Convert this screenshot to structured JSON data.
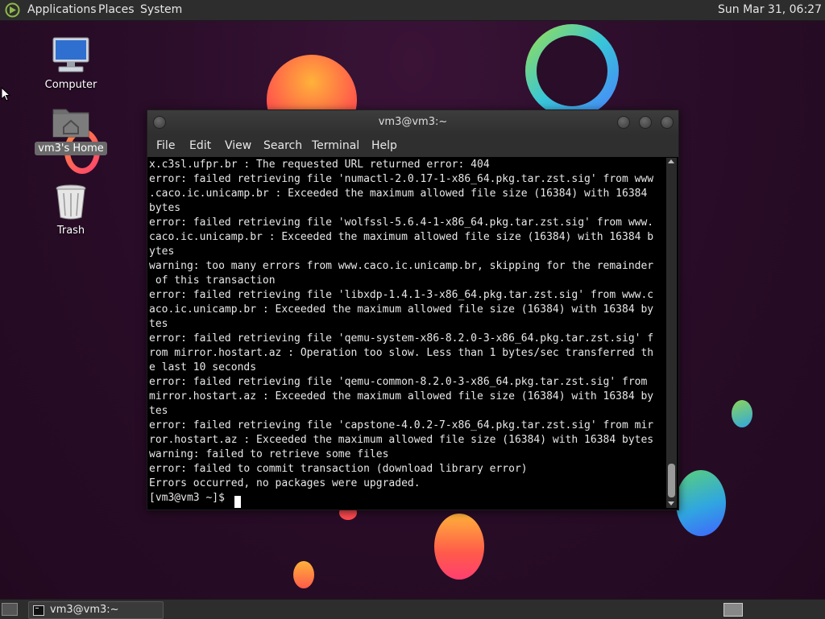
{
  "top_panel": {
    "menus": [
      "Applications",
      "Places",
      "System"
    ],
    "clock": "Sun Mar 31, 06:27"
  },
  "desktop": {
    "icons": [
      {
        "label": "Computer",
        "icon": "computer-icon"
      },
      {
        "label": "vm3's Home",
        "icon": "home-folder-icon"
      },
      {
        "label": "Trash",
        "icon": "trash-icon"
      }
    ]
  },
  "terminal": {
    "title": "vm3@vm3:~",
    "menu": [
      "File",
      "Edit",
      "View",
      "Search",
      "Terminal",
      "Help"
    ],
    "lines": [
      "x.c3sl.ufpr.br : The requested URL returned error: 404",
      "error: failed retrieving file 'numactl-2.0.17-1-x86_64.pkg.tar.zst.sig' from www",
      ".caco.ic.unicamp.br : Exceeded the maximum allowed file size (16384) with 16384",
      "bytes",
      "error: failed retrieving file 'wolfssl-5.6.4-1-x86_64.pkg.tar.zst.sig' from www.",
      "caco.ic.unicamp.br : Exceeded the maximum allowed file size (16384) with 16384 b",
      "ytes",
      "warning: too many errors from www.caco.ic.unicamp.br, skipping for the remainder",
      " of this transaction",
      "error: failed retrieving file 'libxdp-1.4.1-3-x86_64.pkg.tar.zst.sig' from www.c",
      "aco.ic.unicamp.br : Exceeded the maximum allowed file size (16384) with 16384 by",
      "tes",
      "error: failed retrieving file 'qemu-system-x86-8.2.0-3-x86_64.pkg.tar.zst.sig' f",
      "rom mirror.hostart.az : Operation too slow. Less than 1 bytes/sec transferred th",
      "e last 10 seconds",
      "error: failed retrieving file 'qemu-common-8.2.0-3-x86_64.pkg.tar.zst.sig' from",
      "mirror.hostart.az : Exceeded the maximum allowed file size (16384) with 16384 by",
      "tes",
      "error: failed retrieving file 'capstone-4.0.2-7-x86_64.pkg.tar.zst.sig' from mir",
      "ror.hostart.az : Exceeded the maximum allowed file size (16384) with 16384 bytes",
      "warning: failed to retrieve some files",
      "error: failed to commit transaction (download library error)",
      "Errors occurred, no packages were upgraded.",
      "[vm3@vm3 ~]$ "
    ]
  },
  "taskbar": {
    "window_button_label": "vm3@vm3:~"
  }
}
